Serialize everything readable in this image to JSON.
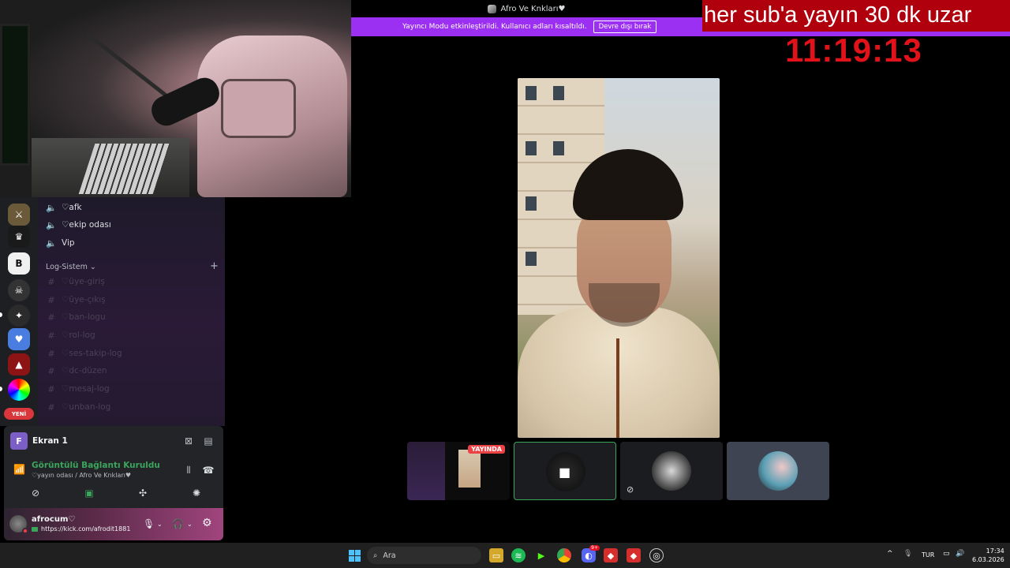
{
  "overlay": {
    "ticker_text": "her sub'a yayın 30 dk uzar",
    "timer": "11:19:13"
  },
  "window": {
    "server_title": "Afro Ve Knkları♥"
  },
  "streamer_banner": {
    "message": "Yayıncı Modu etkinleştirildi. Kullanıcı adları kısaltıldı.",
    "button_label": "Devre dışı bırak"
  },
  "sidebar": {
    "new_badge": "YENİ",
    "voice_channels": [
      {
        "name": "♡afk"
      },
      {
        "name": "♡ekip odası"
      },
      {
        "name": "Vip"
      }
    ],
    "category": {
      "name": "Log-Sistem"
    },
    "text_channels": [
      {
        "name": "♡üye-giriş"
      },
      {
        "name": "♡üye-çıkış"
      },
      {
        "name": "♡ban-logu"
      },
      {
        "name": "♡rol-log"
      },
      {
        "name": "♡ses-takip-log"
      },
      {
        "name": "♡dc-düzen"
      },
      {
        "name": "♡mesaj-log"
      },
      {
        "name": "♡unban-log"
      }
    ]
  },
  "voice_panel": {
    "stream_label": "Ekran 1",
    "stream_avatar_letter": "F",
    "status": "Görüntülü Bağlantı Kuruldu",
    "location": "♡yayın odası / Afro Ve Knkları♥"
  },
  "user": {
    "name": "afrocum♡",
    "status": "https://kick.com/afrodit1881"
  },
  "call": {
    "live_badge": "YAYINDA"
  },
  "taskbar": {
    "search_placeholder": "Ara",
    "discord_badge": "9+",
    "language": "TUR",
    "time": "17:34",
    "date": "6.03.2026"
  }
}
